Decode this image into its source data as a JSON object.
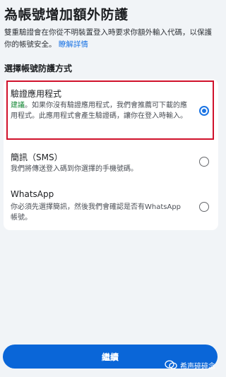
{
  "header": {
    "title": "為帳號增加額外防護",
    "description": "雙重驗證會在你從不明裝置登入時要求你額外輸入代碼，以保護你的帳號安全。",
    "learn_more": "瞭解詳情"
  },
  "section_title": "選擇帳號防護方式",
  "options": [
    {
      "label": "驗證應用程式",
      "recommended": "建議",
      "description": "。如果你沒有驗證應用程式，我們會推薦可下載的應用程式。此應用程式會產生驗證碼，讓你在登入時輸入。",
      "selected": true
    },
    {
      "label": "簡訊（SMS）",
      "description": "我們將傳送登入碼到你選擇的手機號碼。",
      "selected": false
    },
    {
      "label": "WhatsApp",
      "description": "你必須先選擇簡訊，然後我們會確認是否有WhatsApp 帳號。",
      "selected": false
    }
  ],
  "continue_button": "繼續",
  "watermark": "希声碎碎念",
  "colors": {
    "accent": "#1b74e4",
    "button": "#0a66d8",
    "recommended": "#1a8a3a",
    "highlight_box": "#d0112b",
    "background": "#f1f4f7"
  }
}
